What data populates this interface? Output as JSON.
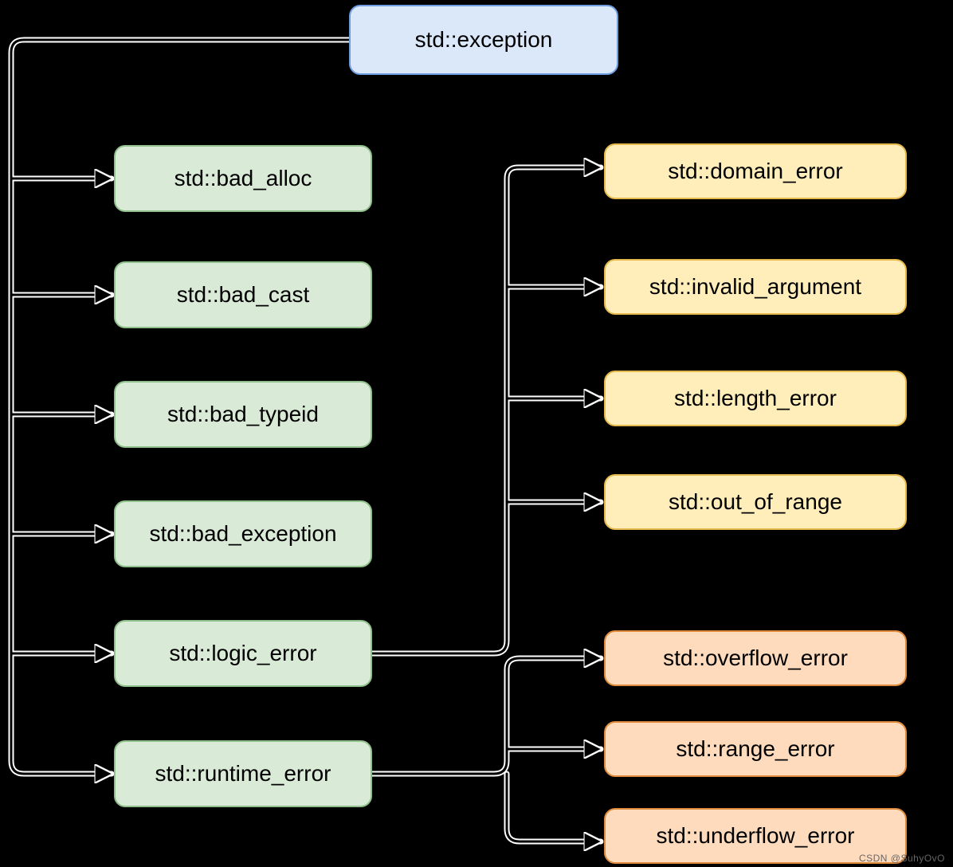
{
  "root": {
    "label": "std::exception"
  },
  "direct": [
    {
      "label": "std::bad_alloc"
    },
    {
      "label": "std::bad_cast"
    },
    {
      "label": "std::bad_typeid"
    },
    {
      "label": "std::bad_exception"
    },
    {
      "label": "std::logic_error"
    },
    {
      "label": "std::runtime_error"
    }
  ],
  "logic_children": [
    {
      "label": "std::domain_error"
    },
    {
      "label": "std::invalid_argument"
    },
    {
      "label": "std::length_error"
    },
    {
      "label": "std::out_of_range"
    }
  ],
  "runtime_children": [
    {
      "label": "std::overflow_error"
    },
    {
      "label": "std::range_error"
    },
    {
      "label": "std::underflow_error"
    }
  ],
  "watermark": "CSDN @SuhyOvO"
}
